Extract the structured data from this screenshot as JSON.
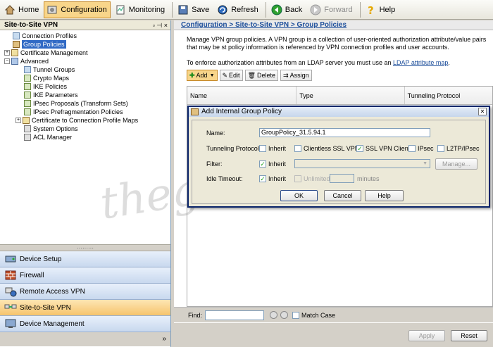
{
  "toolbar": {
    "items": [
      {
        "label": "Home",
        "icon": "home-icon"
      },
      {
        "label": "Configuration",
        "icon": "configuration-icon",
        "active": true
      },
      {
        "label": "Monitoring",
        "icon": "monitoring-icon"
      },
      {
        "label": "Save",
        "icon": "save-icon"
      },
      {
        "label": "Refresh",
        "icon": "refresh-icon"
      },
      {
        "label": "Back",
        "icon": "back-icon"
      },
      {
        "label": "Forward",
        "icon": "forward-icon",
        "disabled": true
      },
      {
        "label": "Help",
        "icon": "help-icon"
      }
    ]
  },
  "left_panel": {
    "title": "Site-to-Site VPN",
    "tree": [
      {
        "label": "Connection Profiles"
      },
      {
        "label": "Group Policies",
        "selected": true
      },
      {
        "label": "Certificate Management"
      },
      {
        "label": "Advanced"
      },
      {
        "label": "Tunnel Groups"
      },
      {
        "label": "Crypto Maps"
      },
      {
        "label": "IKE Policies"
      },
      {
        "label": "IKE Parameters"
      },
      {
        "label": "IPsec Proposals (Transform Sets)"
      },
      {
        "label": "IPsec Prefragmentation Policies"
      },
      {
        "label": "Certificate to Connection Profile Maps"
      },
      {
        "label": "System Options"
      },
      {
        "label": "ACL Manager"
      }
    ],
    "nav": [
      {
        "label": "Device Setup",
        "icon": "device-setup-icon"
      },
      {
        "label": "Firewall",
        "icon": "firewall-icon"
      },
      {
        "label": "Remote Access VPN",
        "icon": "remote-access-vpn-icon"
      },
      {
        "label": "Site-to-Site VPN",
        "icon": "site-to-site-vpn-icon",
        "active": true
      },
      {
        "label": "Device Management",
        "icon": "device-management-icon"
      }
    ]
  },
  "main": {
    "breadcrumb": "Configuration > Site-to-Site VPN > Group Policies",
    "description": "Manage VPN group policies. A VPN group is a collection of user-oriented authorization attribute/value pairs that may be st policy information is referenced by VPN connection profiles and user accounts.",
    "ldap_text": "To enforce authorization attributes from an LDAP server you must use an",
    "ldap_link": "LDAP attribute map",
    "ldap_suffix": ".",
    "actions": {
      "add": "Add",
      "edit": "Edit",
      "delete": "Delete",
      "assign": "Assign"
    },
    "columns": [
      "Name",
      "Type",
      "Tunneling Protocol"
    ],
    "find_label": "Find:",
    "match_case": "Match Case",
    "apply": "Apply",
    "reset": "Reset"
  },
  "dialog": {
    "title": "Add Internal Group Policy",
    "name_label": "Name:",
    "name_value": "GroupPolicy_31.5.94.1",
    "tunneling_label": "Tunneling Protocols:",
    "protocols": [
      {
        "label": "Inherit",
        "checked": false
      },
      {
        "label": "Clientless SSL VPN",
        "checked": false
      },
      {
        "label": "SSL VPN Client",
        "checked": true
      },
      {
        "label": "IPsec",
        "checked": false
      },
      {
        "label": "L2TP/IPsec",
        "checked": false
      }
    ],
    "filter_label": "Filter:",
    "filter_inherit": "Inherit",
    "manage": "Manage...",
    "idle_label": "Idle Timeout:",
    "idle_inherit": "Inherit",
    "unlimited": "Unlimited",
    "minutes": "minutes",
    "ok": "OK",
    "cancel": "Cancel",
    "help": "Help"
  },
  "watermark": "thegioimang.vn",
  "colors": {
    "accent": "#f8d58a",
    "link": "#1b4d9a",
    "selected": "#316ac5"
  }
}
